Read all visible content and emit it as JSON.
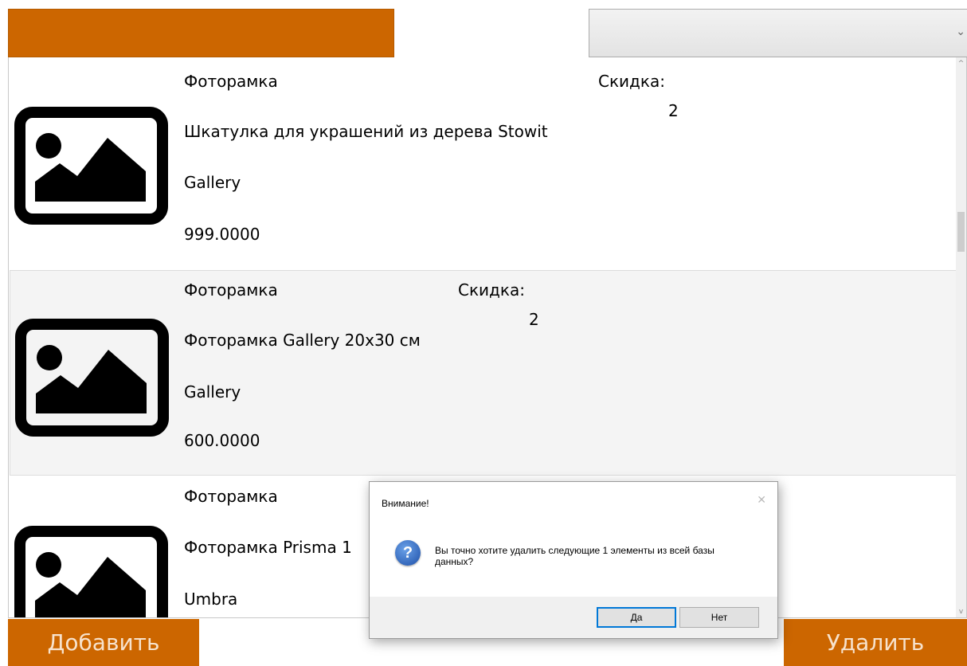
{
  "header": {
    "accent_color": "#cc6600",
    "sort_combo_value": ""
  },
  "products": [
    {
      "category": "Фоторамка",
      "name": "Шкатулка для украшений из дерева Stowit",
      "manufacturer": "Gallery",
      "price": "999.0000",
      "discount_label": "Скидка:",
      "discount_value": "2",
      "image_icon": "image-placeholder-icon"
    },
    {
      "category": "Фоторамка",
      "name": "Фоторамка Gallery 20х30 см",
      "manufacturer": "Gallery",
      "price": "600.0000",
      "discount_label": "Скидка:",
      "discount_value": "2",
      "image_icon": "image-placeholder-icon",
      "selected": true
    },
    {
      "category": "Фоторамка",
      "name": "Фоторамка Prisma 1",
      "manufacturer": "Umbra",
      "image_icon": "image-placeholder-icon"
    }
  ],
  "buttons": {
    "add": "Добавить",
    "delete": "Удалить"
  },
  "dialog": {
    "title": "Внимание!",
    "message": "Вы точно хотите удалить следующие 1 элементы из всей базы данных?",
    "yes": "Да",
    "no": "Нет",
    "icon": "question-icon"
  }
}
